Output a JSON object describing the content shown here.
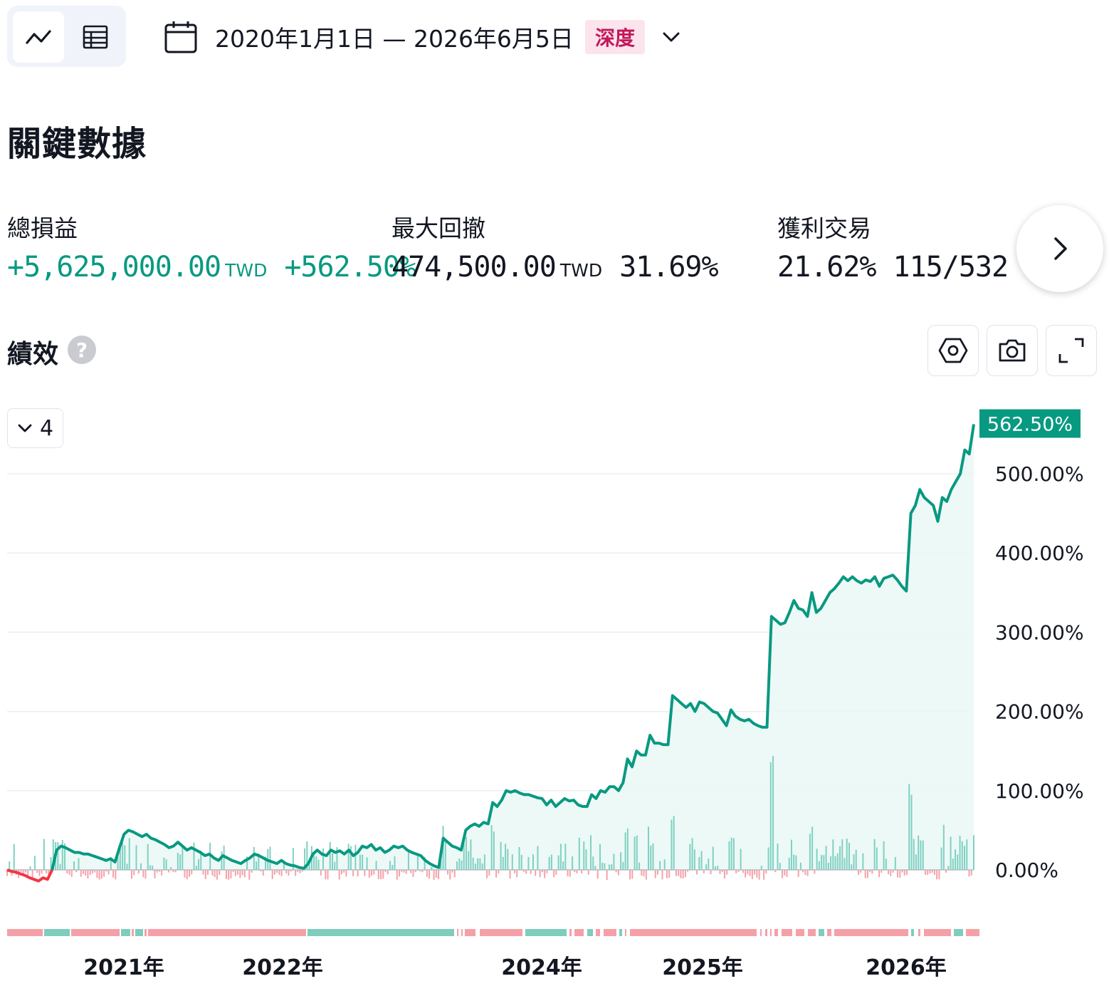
{
  "toolbar": {
    "view_chart_icon": "line-chart-icon",
    "view_table_icon": "table-icon",
    "date_range": "2020年1月1日 — 2026年6月5日",
    "depth_badge": "深度",
    "calendar_icon": "calendar-icon",
    "dropdown_icon": "chevron-down-icon"
  },
  "key_stats": {
    "title": "關鍵數據",
    "net_profit": {
      "label": "總損益",
      "value": "+5,625,000.00",
      "currency": "TWD",
      "percent": "+562.50%"
    },
    "max_drawdown": {
      "label": "最大回撤",
      "value": "474,500.00",
      "currency": "TWD",
      "percent": "31.69%"
    },
    "profitable_trades": {
      "label": "獲利交易",
      "percent": "21.62%",
      "ratio": "115/532"
    },
    "next_icon": "chevron-right-icon"
  },
  "performance": {
    "title": "績效",
    "help": "?",
    "series_toggle_count": "4",
    "tools": [
      "settings-hexagon-icon",
      "camera-icon",
      "fullscreen-icon"
    ]
  },
  "chart_data": {
    "type": "line",
    "x_ticks": [
      "2021年",
      "2022年",
      "2024年",
      "2025年",
      "2026年"
    ],
    "y_ticks": [
      "0.00%",
      "100.00%",
      "200.00%",
      "300.00%",
      "400.00%",
      "500.00%"
    ],
    "ylim": [
      0,
      562.5
    ],
    "last_value_label": "562.50%",
    "colors": {
      "line": "#089981",
      "negative": "#f23645",
      "fill": "#e8f7f4",
      "bar_pos": "#7fd1c2",
      "bar_neg": "#f7a1a8",
      "strip_pos": "#7ecdbd",
      "strip_neg": "#f5a0a8",
      "grid": "#eceef2"
    },
    "series": [
      {
        "values": [
          0,
          -2,
          -3,
          -5,
          -7,
          -10,
          -12,
          -14,
          -10,
          -12,
          0,
          25,
          30,
          28,
          25,
          22,
          22,
          20,
          20,
          18,
          16,
          14,
          12,
          14,
          10,
          28,
          45,
          50,
          48,
          45,
          42,
          45,
          40,
          38,
          35,
          32,
          28,
          30,
          35,
          30,
          25,
          28,
          25,
          22,
          18,
          20,
          15,
          12,
          18,
          15,
          12,
          10,
          8,
          12,
          15,
          20,
          18,
          15,
          12,
          10,
          8,
          12,
          8,
          6,
          5,
          3,
          2,
          8,
          20,
          25,
          20,
          18,
          25,
          22,
          24,
          20,
          25,
          18,
          22,
          30,
          28,
          32,
          25,
          28,
          22,
          25,
          30,
          28,
          30,
          25,
          22,
          20,
          18,
          12,
          8,
          5,
          3,
          40,
          35,
          30,
          28,
          25,
          50,
          55,
          58,
          55,
          60,
          58,
          85,
          80,
          88,
          100,
          98,
          100,
          97,
          95,
          95,
          93,
          91,
          90,
          82,
          88,
          80,
          85,
          90,
          87,
          88,
          82,
          80,
          80,
          95,
          90,
          100,
          98,
          105,
          105,
          100,
          110,
          140,
          130,
          150,
          145,
          145,
          170,
          160,
          160,
          158,
          158,
          220,
          215,
          210,
          205,
          210,
          200,
          212,
          210,
          205,
          200,
          198,
          190,
          182,
          202,
          194,
          190,
          188,
          190,
          185,
          182,
          180,
          180,
          320,
          315,
          310,
          312,
          325,
          340,
          330,
          328,
          320,
          350,
          325,
          330,
          340,
          350,
          355,
          362,
          370,
          365,
          370,
          365,
          362,
          366,
          364,
          370,
          358,
          368,
          370,
          372,
          366,
          358,
          352,
          450,
          460,
          480,
          470,
          465,
          460,
          440,
          470,
          465,
          480,
          490,
          500,
          530,
          525,
          562.5
        ]
      }
    ]
  }
}
